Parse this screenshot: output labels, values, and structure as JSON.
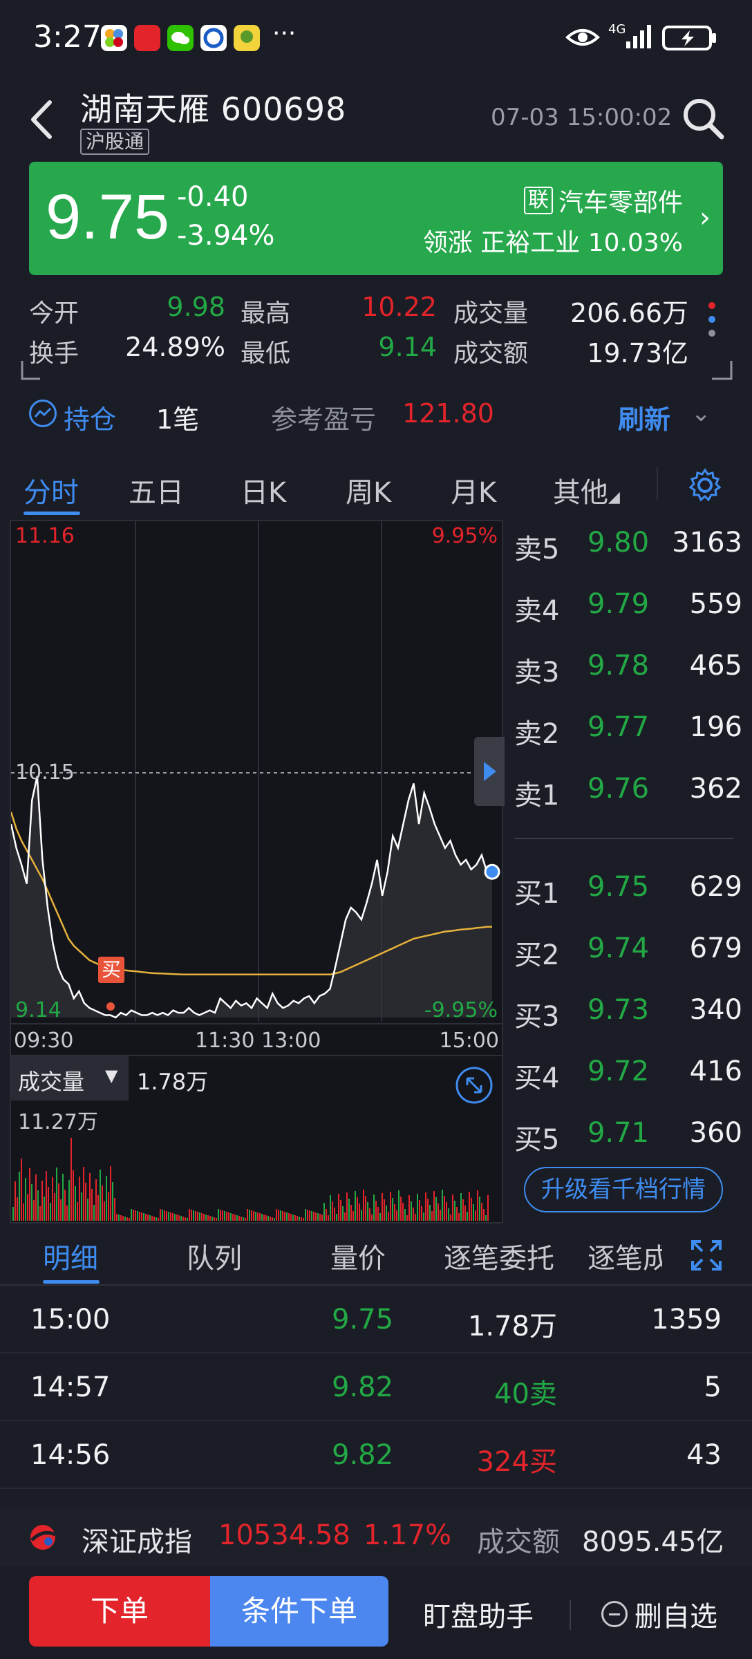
{
  "status_bar": {
    "time": "3:27",
    "more": "···",
    "network": "4G"
  },
  "header": {
    "title": "湖南天雁 600698",
    "tag": "沪股通",
    "time": "07-03 15:00:02"
  },
  "price": {
    "last": "9.75",
    "change": "-0.40",
    "change_pct": "-3.94%",
    "sector_badge": "联",
    "sector": "汽车零部件",
    "leader_label": "领涨",
    "leader_name": "正裕工业",
    "leader_pct": "10.03%"
  },
  "stats": [
    {
      "label": "今开",
      "value": "9.98",
      "color": "green"
    },
    {
      "label": "最高",
      "value": "10.22",
      "color": "red"
    },
    {
      "label": "成交量",
      "value": "206.66万",
      "color": "white"
    },
    {
      "label": "换手",
      "value": "24.89%",
      "color": "white"
    },
    {
      "label": "最低",
      "value": "9.14",
      "color": "green"
    },
    {
      "label": "成交额",
      "value": "19.73亿",
      "color": "white"
    }
  ],
  "holdings": {
    "label": "持仓",
    "count": "1笔",
    "pnl_label": "参考盈亏",
    "pnl_value": "121.80",
    "refresh": "刷新"
  },
  "chart_tabs": [
    "分时",
    "五日",
    "日K",
    "周K",
    "月K",
    "其他"
  ],
  "chart_data": {
    "type": "line",
    "price_axis": {
      "max": "11.16",
      "mid": "10.15",
      "min": "9.14"
    },
    "pct_axis": {
      "max": "9.95%",
      "min": "-9.95%"
    },
    "time_labels": [
      "09:30",
      "11:30 13:00",
      "15:00"
    ],
    "buy_marker": "买",
    "price_range": [
      9.14,
      11.16
    ],
    "series": [
      {
        "values": [
          9.95,
          9.85,
          9.78,
          9.7,
          10.05,
          10.15,
          9.8,
          9.6,
          9.45,
          9.35,
          9.3,
          9.28,
          9.22,
          9.25,
          9.2,
          9.18,
          9.17,
          9.16,
          9.15,
          9.15,
          9.14,
          9.16,
          9.15,
          9.17,
          9.16,
          9.15,
          9.15,
          9.16,
          9.15,
          9.16,
          9.15,
          9.17,
          9.16,
          9.16,
          9.18,
          9.16,
          9.15,
          9.16,
          9.17,
          9.16,
          9.22,
          9.2,
          9.18,
          9.21,
          9.19,
          9.2,
          9.18,
          9.22,
          9.2,
          9.18,
          9.24,
          9.2,
          9.18,
          9.19,
          9.21,
          9.2,
          9.22,
          9.23,
          9.2,
          9.23,
          9.24,
          9.26,
          9.35,
          9.45,
          9.55,
          9.6,
          9.58,
          9.55,
          9.62,
          9.7,
          9.8,
          9.65,
          9.75,
          9.9,
          9.85,
          9.95,
          10.05,
          10.12,
          9.95,
          10.08,
          10.02,
          9.95,
          9.9,
          9.85,
          9.88,
          9.82,
          9.78,
          9.8,
          9.76,
          9.78,
          9.82,
          9.75,
          9.75
        ]
      },
      {
        "values": [
          10.0,
          9.93,
          9.88,
          9.84,
          9.8,
          9.76,
          9.72,
          9.67,
          9.62,
          9.57,
          9.52,
          9.47,
          9.44,
          9.42,
          9.4,
          9.38,
          9.37,
          9.36,
          9.355,
          9.35,
          9.345,
          9.34,
          9.337,
          9.335,
          9.333,
          9.33,
          9.328,
          9.326,
          9.325,
          9.324,
          9.323,
          9.322,
          9.321,
          9.32,
          9.32,
          9.32,
          9.32,
          9.32,
          9.32,
          9.32,
          9.32,
          9.32,
          9.32,
          9.32,
          9.32,
          9.32,
          9.32,
          9.32,
          9.32,
          9.32,
          9.32,
          9.32,
          9.32,
          9.32,
          9.32,
          9.32,
          9.32,
          9.32,
          9.32,
          9.32,
          9.32,
          9.32,
          9.325,
          9.33,
          9.34,
          9.35,
          9.36,
          9.37,
          9.38,
          9.39,
          9.4,
          9.41,
          9.42,
          9.43,
          9.44,
          9.45,
          9.46,
          9.47,
          9.475,
          9.48,
          9.485,
          9.49,
          9.495,
          9.5,
          9.502,
          9.505,
          9.508,
          9.51,
          9.512,
          9.515,
          9.517,
          9.52,
          9.52
        ]
      }
    ]
  },
  "volume": {
    "label": "成交量",
    "current": "1.78万",
    "max": "11.27万"
  },
  "order_book": {
    "asks": [
      {
        "label": "卖5",
        "price": "9.80",
        "vol": "3163"
      },
      {
        "label": "卖4",
        "price": "9.79",
        "vol": "559"
      },
      {
        "label": "卖3",
        "price": "9.78",
        "vol": "465"
      },
      {
        "label": "卖2",
        "price": "9.77",
        "vol": "196"
      },
      {
        "label": "卖1",
        "price": "9.76",
        "vol": "362"
      }
    ],
    "bids": [
      {
        "label": "买1",
        "price": "9.75",
        "vol": "629"
      },
      {
        "label": "买2",
        "price": "9.74",
        "vol": "679"
      },
      {
        "label": "买3",
        "price": "9.73",
        "vol": "340"
      },
      {
        "label": "买4",
        "price": "9.72",
        "vol": "416"
      },
      {
        "label": "买5",
        "price": "9.71",
        "vol": "360"
      }
    ],
    "upgrade": "升级看千档行情"
  },
  "detail_tabs": [
    "明细",
    "队列",
    "量价",
    "逐笔委托",
    "逐笔成"
  ],
  "ticks": [
    {
      "time": "15:00",
      "price": "9.75",
      "vol": "1.78万",
      "vol_color": "white",
      "n": "1359"
    },
    {
      "time": "14:57",
      "price": "9.82",
      "vol": "40卖",
      "vol_color": "green",
      "n": "5"
    },
    {
      "time": "14:56",
      "price": "9.82",
      "vol": "324买",
      "vol_color": "red",
      "n": "43"
    }
  ],
  "index_bar": {
    "name": "深证成指",
    "value": "10534.58",
    "pct": "1.17%",
    "amount_label": "成交额",
    "amount": "8095.45亿"
  },
  "bottom": {
    "order": "下单",
    "cond_order": "条件下单",
    "watch": "盯盘助手",
    "unfav": "删自选"
  }
}
